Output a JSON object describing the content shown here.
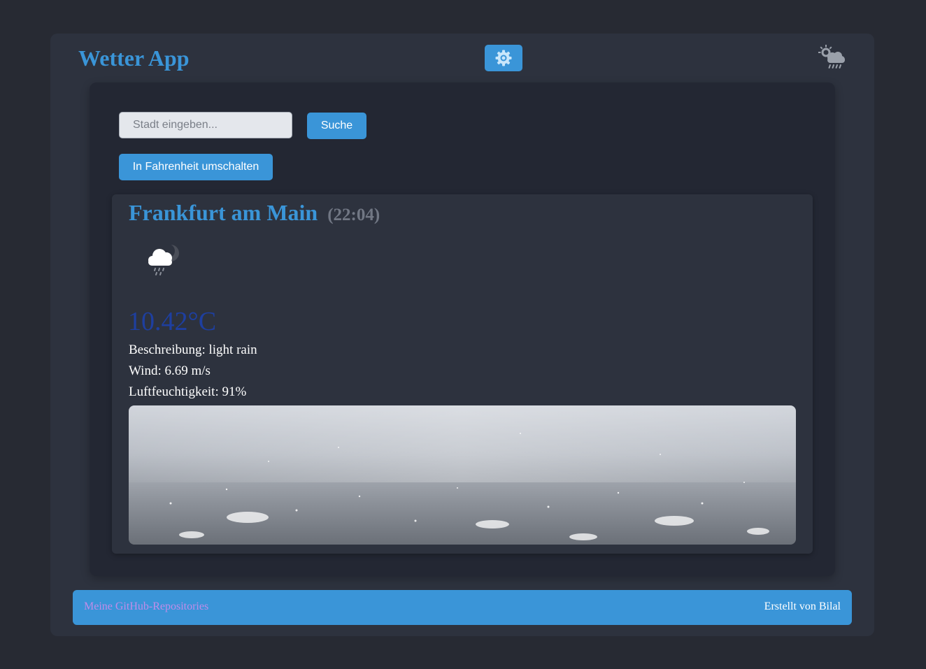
{
  "header": {
    "title": "Wetter App",
    "settings_icon": "gear-icon",
    "weather_icon": "cloud-sun-rain-icon"
  },
  "search": {
    "placeholder": "Stadt eingeben...",
    "value": "",
    "button_label": "Suche"
  },
  "unit_toggle": {
    "label": "In Fahrenheit umschalten"
  },
  "weather": {
    "city": "Frankfurt am Main",
    "time": "(22:04)",
    "condition_icon": "cloud-moon-rain-icon",
    "temperature": "10.42°C",
    "description": "Beschreibung: light rain",
    "wind": "Wind: 6.69 m/s",
    "humidity": "Luftfeuchtigkeit: 91%"
  },
  "footer": {
    "link_label": "Meine GitHub-Repositories",
    "credit": "Erstellt von Bilal"
  },
  "colors": {
    "page_bg": "#272a33",
    "panel_bg": "#2d323e",
    "content_bg": "#232733",
    "accent": "#3a95d8",
    "temperature": "#1e3fa0",
    "time": "#717784",
    "footer_link": "#c08ce8"
  }
}
